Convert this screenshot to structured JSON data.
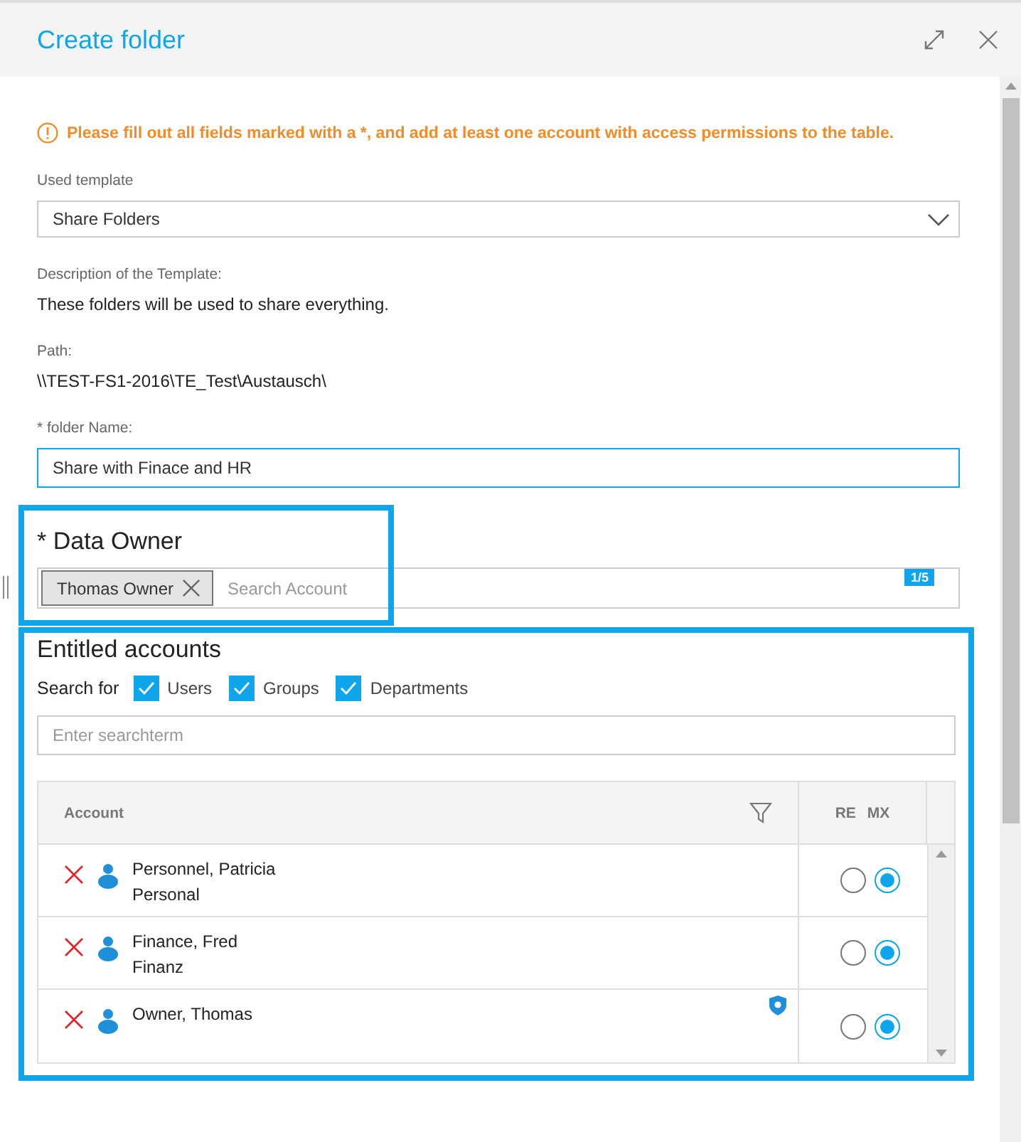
{
  "window": {
    "title": "Create folder"
  },
  "warning": "Please fill out all fields marked with a *, and add at least one account with access permissions to the table.",
  "template": {
    "label": "Used template",
    "value": "Share Folders"
  },
  "description": {
    "label": "Description of the Template:",
    "text": "These folders will be used to share everything."
  },
  "path": {
    "label": "Path:",
    "text": "\\\\TEST-FS1-2016\\TE_Test\\Austausch\\"
  },
  "folder_name": {
    "label": "* folder Name:",
    "value": "Share with Finace and HR"
  },
  "data_owner": {
    "title": "* Data Owner",
    "tags": [
      "Thomas Owner"
    ],
    "placeholder": "Search Account",
    "count": "1/5",
    "highlighted": true
  },
  "entitled": {
    "title": "Entitled accounts",
    "highlighted": true,
    "search_label": "Search for",
    "filters": [
      {
        "label": "Users",
        "checked": true
      },
      {
        "label": "Groups",
        "checked": true
      },
      {
        "label": "Departments",
        "checked": true
      }
    ],
    "search": {
      "placeholder": "Enter searchterm"
    },
    "table": {
      "columns": [
        "Account",
        "RE",
        "MX"
      ],
      "rows": [
        {
          "name": "Personnel, Patricia",
          "department": "Personal",
          "owner": false,
          "rights": [
            {
              "selected": false
            },
            {
              "selected": true
            }
          ]
        },
        {
          "name": "Finance, Fred",
          "department": "Finanz",
          "owner": false,
          "rights": [
            {
              "selected": false
            },
            {
              "selected": true
            }
          ]
        },
        {
          "name": "Owner, Thomas",
          "owner": true,
          "rights": [
            {
              "selected": false
            },
            {
              "selected": true
            }
          ]
        }
      ]
    }
  }
}
